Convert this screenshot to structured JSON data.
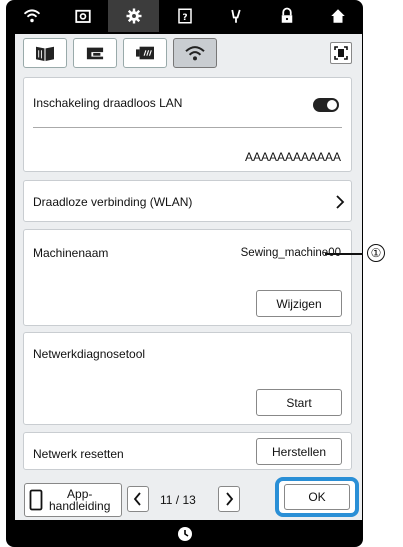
{
  "wlan_toggle": {
    "label": "Inschakeling draadloos LAN",
    "state": "on"
  },
  "ssid_value": "AAAAAAAAAAAA",
  "wireless_connection": {
    "label": "Draadloze verbinding (WLAN)"
  },
  "machine_name": {
    "label": "Machinenaam",
    "value": "Sewing_machine00",
    "button": "Wijzigen"
  },
  "network_diag": {
    "label": "Netwerkdiagnosetool",
    "button": "Start"
  },
  "network_reset": {
    "label": "Netwerk resetten",
    "button": "Herstellen"
  },
  "footer": {
    "app_manual": "App-\nhandleiding",
    "page_indicator": "11 / 13",
    "ok_button": "OK"
  },
  "callout_number": "①",
  "icons": {
    "topbar": [
      "wifi-icon",
      "camera-icon",
      "gear-icon",
      "help-icon",
      "sewing-icon",
      "lock-icon",
      "home-icon"
    ],
    "tabs": [
      "book-icon",
      "sewing-machine-icon",
      "embroidery-icon",
      "wifi-icon"
    ],
    "bottom": "clock-icon"
  },
  "colors": {
    "highlight_frame": "#2a8fd6",
    "active_tab": "#c9cdd1"
  }
}
